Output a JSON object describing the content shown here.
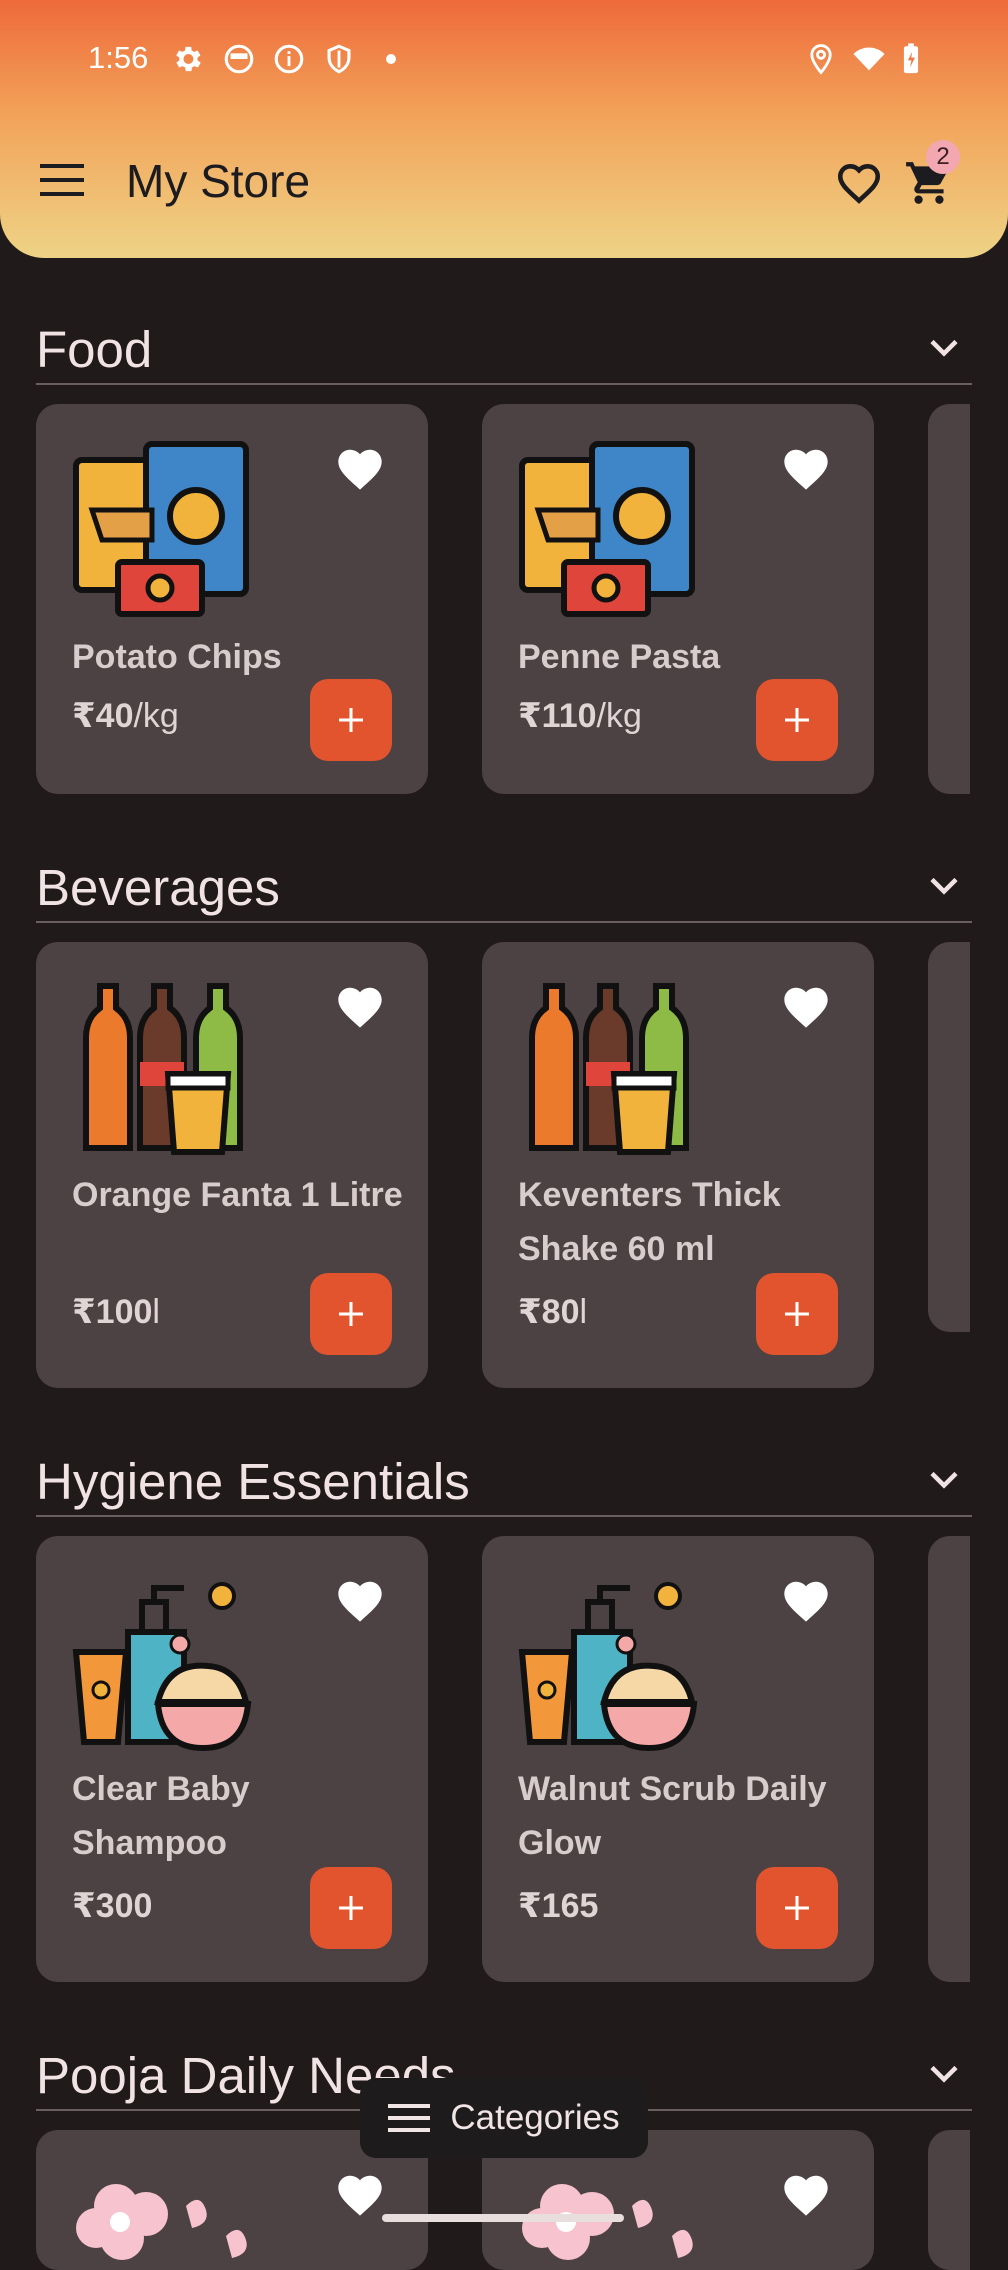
{
  "status_bar": {
    "time": "1:56"
  },
  "toolbar": {
    "title": "My Store",
    "cart_count": "2"
  },
  "sections": [
    {
      "title": "Food",
      "products": [
        {
          "name": "Potato Chips",
          "price": "₹40",
          "unit": "/kg"
        },
        {
          "name": "Penne Pasta",
          "price": "₹110",
          "unit": "/kg"
        }
      ]
    },
    {
      "title": "Beverages",
      "products": [
        {
          "name": "Orange Fanta 1 Litre",
          "price": "₹100",
          "unit": "l"
        },
        {
          "name": "Keventers Thick Shake 60 ml",
          "price": "₹80",
          "unit": "l"
        }
      ]
    },
    {
      "title": "Hygiene Essentials",
      "products": [
        {
          "name": "Clear Baby Shampoo",
          "price": "₹300",
          "unit": ""
        },
        {
          "name": "Walnut Scrub Daily Glow",
          "price": "₹165",
          "unit": ""
        }
      ]
    },
    {
      "title": "Pooja Daily Needs",
      "products": []
    }
  ],
  "categories_button": {
    "label": "Categories"
  },
  "colors": {
    "accent": "#e2542e",
    "card": "#4c4243",
    "background": "#201a1b"
  }
}
